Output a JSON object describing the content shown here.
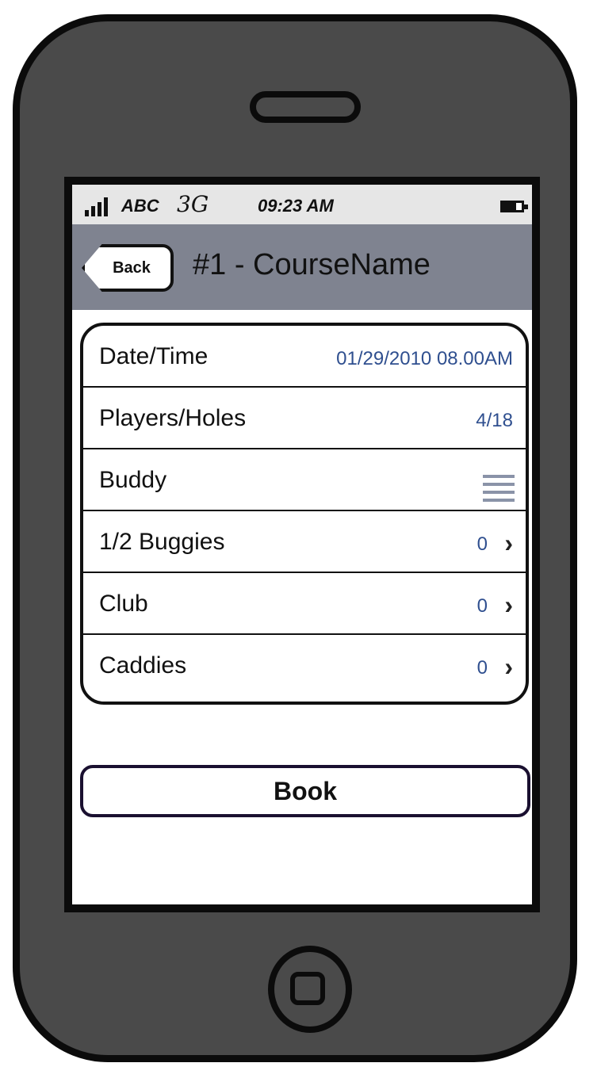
{
  "status_bar": {
    "carrier": "ABC",
    "network": "3G",
    "time": "09:23 AM",
    "signal_icon": "signal-bars-icon",
    "battery_icon": "battery-icon"
  },
  "nav_bar": {
    "back_label": "Back",
    "title": "#1 - CourseName"
  },
  "rows": [
    {
      "label": "Date/Time",
      "value": "01/29/2010 08.00AM"
    },
    {
      "label": "Players/Holes",
      "value": "4/18"
    },
    {
      "label": "Buddy",
      "icon": "list-icon"
    },
    {
      "label": "1/2 Buggies",
      "value": "0",
      "icon": "chevron-right-icon"
    },
    {
      "label": "Club",
      "value": "0",
      "icon": "chevron-right-icon"
    },
    {
      "label": "Caddies",
      "value": "0",
      "icon": "chevron-right-icon"
    }
  ],
  "book_button": {
    "label": "Book"
  },
  "colors": {
    "nav_bar": "#7f8390",
    "value_text": "#2f4f8f",
    "phone_body": "#4a4a4a"
  }
}
